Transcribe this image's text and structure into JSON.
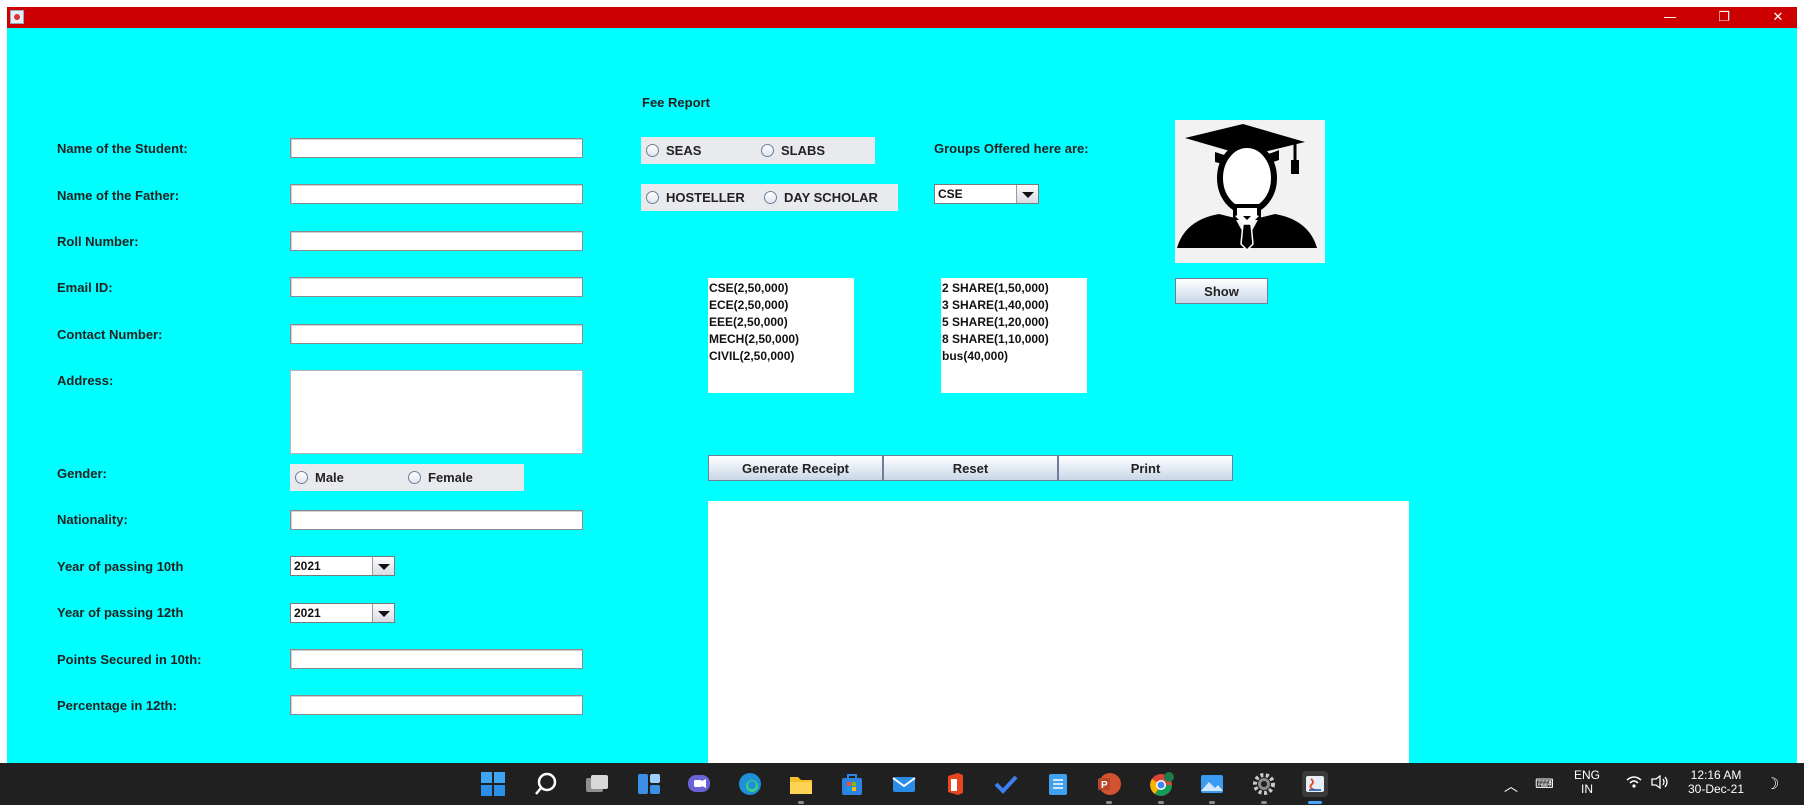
{
  "window": {
    "minimize": "—",
    "maximize": "❐",
    "close": "✕"
  },
  "form": {
    "labels": {
      "student_name": "Name of the Student:",
      "father_name": "Name of the Father:",
      "roll": "Roll Number:",
      "email": "Email ID:",
      "contact": "Contact Number:",
      "address": "Address:",
      "gender": "Gender:",
      "nationality": "Nationality:",
      "year10": "Year of passing 10th",
      "year12": "Year of passing 12th",
      "points10": "Points Secured in 10th:",
      "percent12": "Percentage in 12th:"
    },
    "gender_options": {
      "male": "Male",
      "female": "Female"
    },
    "year10_value": "2021",
    "year12_value": "2021"
  },
  "fee": {
    "title": "Fee Report",
    "school_options": {
      "seas": "SEAS",
      "slabs": "SLABS"
    },
    "stay_options": {
      "hosteller": "HOSTELLER",
      "day_scholar": "DAY SCHOLAR"
    },
    "groups_label": "Groups Offered here are:",
    "group_selected": "CSE",
    "groups_list": [
      "CSE(2,50,000)",
      "ECE(2,50,000)",
      "EEE(2,50,000)",
      "MECH(2,50,000)",
      "CIVIL(2,50,000)"
    ],
    "hostel_list": [
      "2 SHARE(1,50,000)",
      "3 SHARE(1,40,000)",
      "5 SHARE(1,20,000)",
      "8 SHARE(1,10,000)",
      "bus(40,000)"
    ],
    "show_button": "Show",
    "generate_button": "Generate Receipt",
    "reset_button": "Reset",
    "print_button": "Print"
  },
  "taskbar": {
    "language": "ENG",
    "region": "IN",
    "time": "12:16 AM",
    "date": "30-Dec-21"
  }
}
